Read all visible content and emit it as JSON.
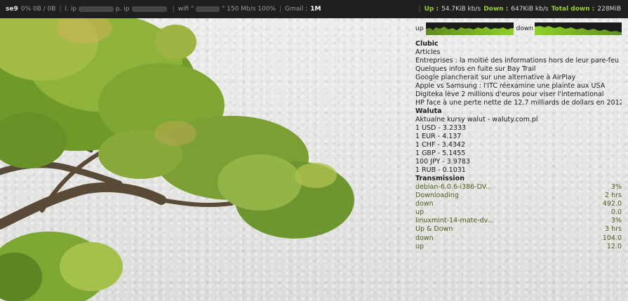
{
  "topbar": {
    "host": "se9",
    "storage": "0% 0B / 0B",
    "lan_label": "l. ip",
    "public_label": "p. ip",
    "wifi_label": "wifi \"",
    "wifi_suffix": "\" 150 Mb/s 100%",
    "gmail_label": "Gmail :",
    "gmail_value": "1M",
    "up_label": "Up :",
    "up_value": "54.7KiB kb/s",
    "down_label": "Down :",
    "down_value": "647KiB kb/s",
    "total_label": "Total down :",
    "total_value": "228MiB"
  },
  "graphs": {
    "up_label": "up",
    "down_label": "down"
  },
  "clubic": {
    "title": "Clubic",
    "items": [
      "Articles",
      "Entreprises : la moitié des informations hors de leur pare-feu",
      "Quelques infos en fuite sur Bay Trail",
      "Google plancherait sur une alternative à AirPlay",
      "Apple vs Samsung : l'ITC réexamine une plainte aux USA",
      "Digiteka lève 2 millions d'euros pour viser l'international",
      "HP face à une perte nette de 12,7 milliards de dollars en 2012"
    ]
  },
  "waluta": {
    "title": "Waluta",
    "items": [
      "Aktualne kursy walut - waluty.com.pl",
      "1 USD - 3.2333",
      "1 EUR - 4.137",
      "1 CHF - 3.4342",
      "1 GBP - 5.1455",
      "100 JPY - 3.9783",
      "1 RUB - 0.1031"
    ]
  },
  "transmission": {
    "title": "Transmission",
    "rows": [
      [
        "debian-6.0.6-i386-DV...",
        "3%"
      ],
      [
        "Downloading",
        "2 hrs"
      ],
      [
        "down",
        "492.0"
      ],
      [
        "up",
        "0.0"
      ],
      [
        "linuxmint-14-mate-dv...",
        "3%"
      ],
      [
        "Up & Down",
        "3 hrs"
      ],
      [
        "down",
        "104.0"
      ],
      [
        "up",
        "12.0"
      ]
    ]
  }
}
